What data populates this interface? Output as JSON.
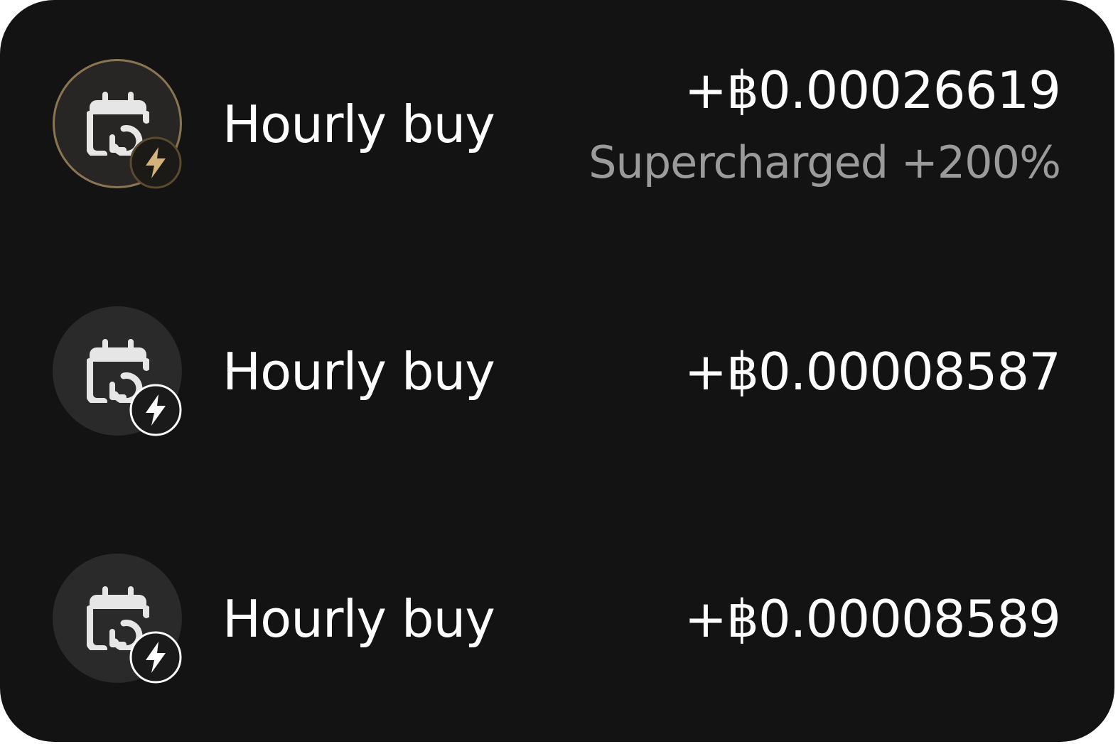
{
  "colors": {
    "card_background": "#131313",
    "text_primary": "#ffffff",
    "text_secondary": "#9b9b9b",
    "supercharged_accent": "#d4b27a"
  },
  "transactions": [
    {
      "title": "Hourly buy",
      "amount": "+฿0.00026619",
      "subtitle": "Supercharged +200%",
      "icon": "calendar-repeat-icon",
      "badge_icon": "lightning-bolt-icon",
      "supercharged": true
    },
    {
      "title": "Hourly buy",
      "amount": "+฿0.00008587",
      "icon": "calendar-repeat-icon",
      "badge_icon": "lightning-bolt-icon",
      "supercharged": false
    },
    {
      "title": "Hourly buy",
      "amount": "+฿0.00008589",
      "icon": "calendar-repeat-icon",
      "badge_icon": "lightning-bolt-icon",
      "supercharged": false
    }
  ]
}
